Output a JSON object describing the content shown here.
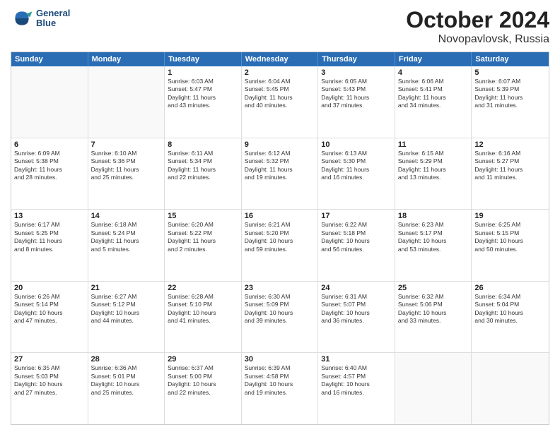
{
  "header": {
    "logo_line1": "General",
    "logo_line2": "Blue",
    "month": "October 2024",
    "location": "Novopavlovsk, Russia"
  },
  "weekdays": [
    "Sunday",
    "Monday",
    "Tuesday",
    "Wednesday",
    "Thursday",
    "Friday",
    "Saturday"
  ],
  "weeks": [
    [
      {
        "day": "",
        "lines": [],
        "empty": true
      },
      {
        "day": "",
        "lines": [],
        "empty": true
      },
      {
        "day": "1",
        "lines": [
          "Sunrise: 6:03 AM",
          "Sunset: 5:47 PM",
          "Daylight: 11 hours",
          "and 43 minutes."
        ]
      },
      {
        "day": "2",
        "lines": [
          "Sunrise: 6:04 AM",
          "Sunset: 5:45 PM",
          "Daylight: 11 hours",
          "and 40 minutes."
        ]
      },
      {
        "day": "3",
        "lines": [
          "Sunrise: 6:05 AM",
          "Sunset: 5:43 PM",
          "Daylight: 11 hours",
          "and 37 minutes."
        ]
      },
      {
        "day": "4",
        "lines": [
          "Sunrise: 6:06 AM",
          "Sunset: 5:41 PM",
          "Daylight: 11 hours",
          "and 34 minutes."
        ]
      },
      {
        "day": "5",
        "lines": [
          "Sunrise: 6:07 AM",
          "Sunset: 5:39 PM",
          "Daylight: 11 hours",
          "and 31 minutes."
        ]
      }
    ],
    [
      {
        "day": "6",
        "lines": [
          "Sunrise: 6:09 AM",
          "Sunset: 5:38 PM",
          "Daylight: 11 hours",
          "and 28 minutes."
        ]
      },
      {
        "day": "7",
        "lines": [
          "Sunrise: 6:10 AM",
          "Sunset: 5:36 PM",
          "Daylight: 11 hours",
          "and 25 minutes."
        ]
      },
      {
        "day": "8",
        "lines": [
          "Sunrise: 6:11 AM",
          "Sunset: 5:34 PM",
          "Daylight: 11 hours",
          "and 22 minutes."
        ]
      },
      {
        "day": "9",
        "lines": [
          "Sunrise: 6:12 AM",
          "Sunset: 5:32 PM",
          "Daylight: 11 hours",
          "and 19 minutes."
        ]
      },
      {
        "day": "10",
        "lines": [
          "Sunrise: 6:13 AM",
          "Sunset: 5:30 PM",
          "Daylight: 11 hours",
          "and 16 minutes."
        ]
      },
      {
        "day": "11",
        "lines": [
          "Sunrise: 6:15 AM",
          "Sunset: 5:29 PM",
          "Daylight: 11 hours",
          "and 13 minutes."
        ]
      },
      {
        "day": "12",
        "lines": [
          "Sunrise: 6:16 AM",
          "Sunset: 5:27 PM",
          "Daylight: 11 hours",
          "and 11 minutes."
        ]
      }
    ],
    [
      {
        "day": "13",
        "lines": [
          "Sunrise: 6:17 AM",
          "Sunset: 5:25 PM",
          "Daylight: 11 hours",
          "and 8 minutes."
        ]
      },
      {
        "day": "14",
        "lines": [
          "Sunrise: 6:18 AM",
          "Sunset: 5:24 PM",
          "Daylight: 11 hours",
          "and 5 minutes."
        ]
      },
      {
        "day": "15",
        "lines": [
          "Sunrise: 6:20 AM",
          "Sunset: 5:22 PM",
          "Daylight: 11 hours",
          "and 2 minutes."
        ]
      },
      {
        "day": "16",
        "lines": [
          "Sunrise: 6:21 AM",
          "Sunset: 5:20 PM",
          "Daylight: 10 hours",
          "and 59 minutes."
        ]
      },
      {
        "day": "17",
        "lines": [
          "Sunrise: 6:22 AM",
          "Sunset: 5:18 PM",
          "Daylight: 10 hours",
          "and 56 minutes."
        ]
      },
      {
        "day": "18",
        "lines": [
          "Sunrise: 6:23 AM",
          "Sunset: 5:17 PM",
          "Daylight: 10 hours",
          "and 53 minutes."
        ]
      },
      {
        "day": "19",
        "lines": [
          "Sunrise: 6:25 AM",
          "Sunset: 5:15 PM",
          "Daylight: 10 hours",
          "and 50 minutes."
        ]
      }
    ],
    [
      {
        "day": "20",
        "lines": [
          "Sunrise: 6:26 AM",
          "Sunset: 5:14 PM",
          "Daylight: 10 hours",
          "and 47 minutes."
        ]
      },
      {
        "day": "21",
        "lines": [
          "Sunrise: 6:27 AM",
          "Sunset: 5:12 PM",
          "Daylight: 10 hours",
          "and 44 minutes."
        ]
      },
      {
        "day": "22",
        "lines": [
          "Sunrise: 6:28 AM",
          "Sunset: 5:10 PM",
          "Daylight: 10 hours",
          "and 41 minutes."
        ]
      },
      {
        "day": "23",
        "lines": [
          "Sunrise: 6:30 AM",
          "Sunset: 5:09 PM",
          "Daylight: 10 hours",
          "and 39 minutes."
        ]
      },
      {
        "day": "24",
        "lines": [
          "Sunrise: 6:31 AM",
          "Sunset: 5:07 PM",
          "Daylight: 10 hours",
          "and 36 minutes."
        ]
      },
      {
        "day": "25",
        "lines": [
          "Sunrise: 6:32 AM",
          "Sunset: 5:06 PM",
          "Daylight: 10 hours",
          "and 33 minutes."
        ]
      },
      {
        "day": "26",
        "lines": [
          "Sunrise: 6:34 AM",
          "Sunset: 5:04 PM",
          "Daylight: 10 hours",
          "and 30 minutes."
        ]
      }
    ],
    [
      {
        "day": "27",
        "lines": [
          "Sunrise: 6:35 AM",
          "Sunset: 5:03 PM",
          "Daylight: 10 hours",
          "and 27 minutes."
        ]
      },
      {
        "day": "28",
        "lines": [
          "Sunrise: 6:36 AM",
          "Sunset: 5:01 PM",
          "Daylight: 10 hours",
          "and 25 minutes."
        ]
      },
      {
        "day": "29",
        "lines": [
          "Sunrise: 6:37 AM",
          "Sunset: 5:00 PM",
          "Daylight: 10 hours",
          "and 22 minutes."
        ]
      },
      {
        "day": "30",
        "lines": [
          "Sunrise: 6:39 AM",
          "Sunset: 4:58 PM",
          "Daylight: 10 hours",
          "and 19 minutes."
        ]
      },
      {
        "day": "31",
        "lines": [
          "Sunrise: 6:40 AM",
          "Sunset: 4:57 PM",
          "Daylight: 10 hours",
          "and 16 minutes."
        ]
      },
      {
        "day": "",
        "lines": [],
        "empty": true
      },
      {
        "day": "",
        "lines": [],
        "empty": true
      }
    ]
  ]
}
